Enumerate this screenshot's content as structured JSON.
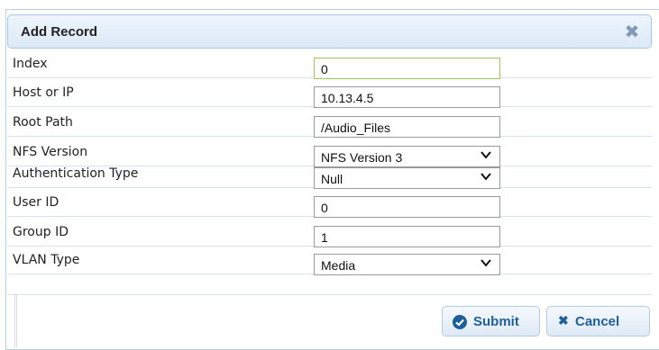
{
  "dialog": {
    "title": "Add Record",
    "close_icon": "close-icon"
  },
  "fields": [
    {
      "label": "Index",
      "value": "0",
      "kind": "input"
    },
    {
      "label": "Host or IP",
      "value": "10.13.4.5",
      "kind": "input"
    },
    {
      "label": "Root Path",
      "value": "/Audio_Files",
      "kind": "input"
    },
    {
      "label": "NFS Version",
      "value": "NFS Version 3",
      "kind": "select"
    },
    {
      "label": "Authentication Type",
      "value": "Null",
      "kind": "select"
    },
    {
      "label": "User ID",
      "value": "0",
      "kind": "input"
    },
    {
      "label": "Group ID",
      "value": "1",
      "kind": "input"
    },
    {
      "label": "VLAN Type",
      "value": "Media",
      "kind": "select"
    }
  ],
  "buttons": {
    "submit_label": "Submit",
    "submit_icon": "check-circle-icon",
    "cancel_label": "Cancel",
    "cancel_icon": "x-icon"
  },
  "colors": {
    "accent": "#1f5f99",
    "title_bar": "#dce9f6",
    "active_field_border": "#9fc45a"
  }
}
